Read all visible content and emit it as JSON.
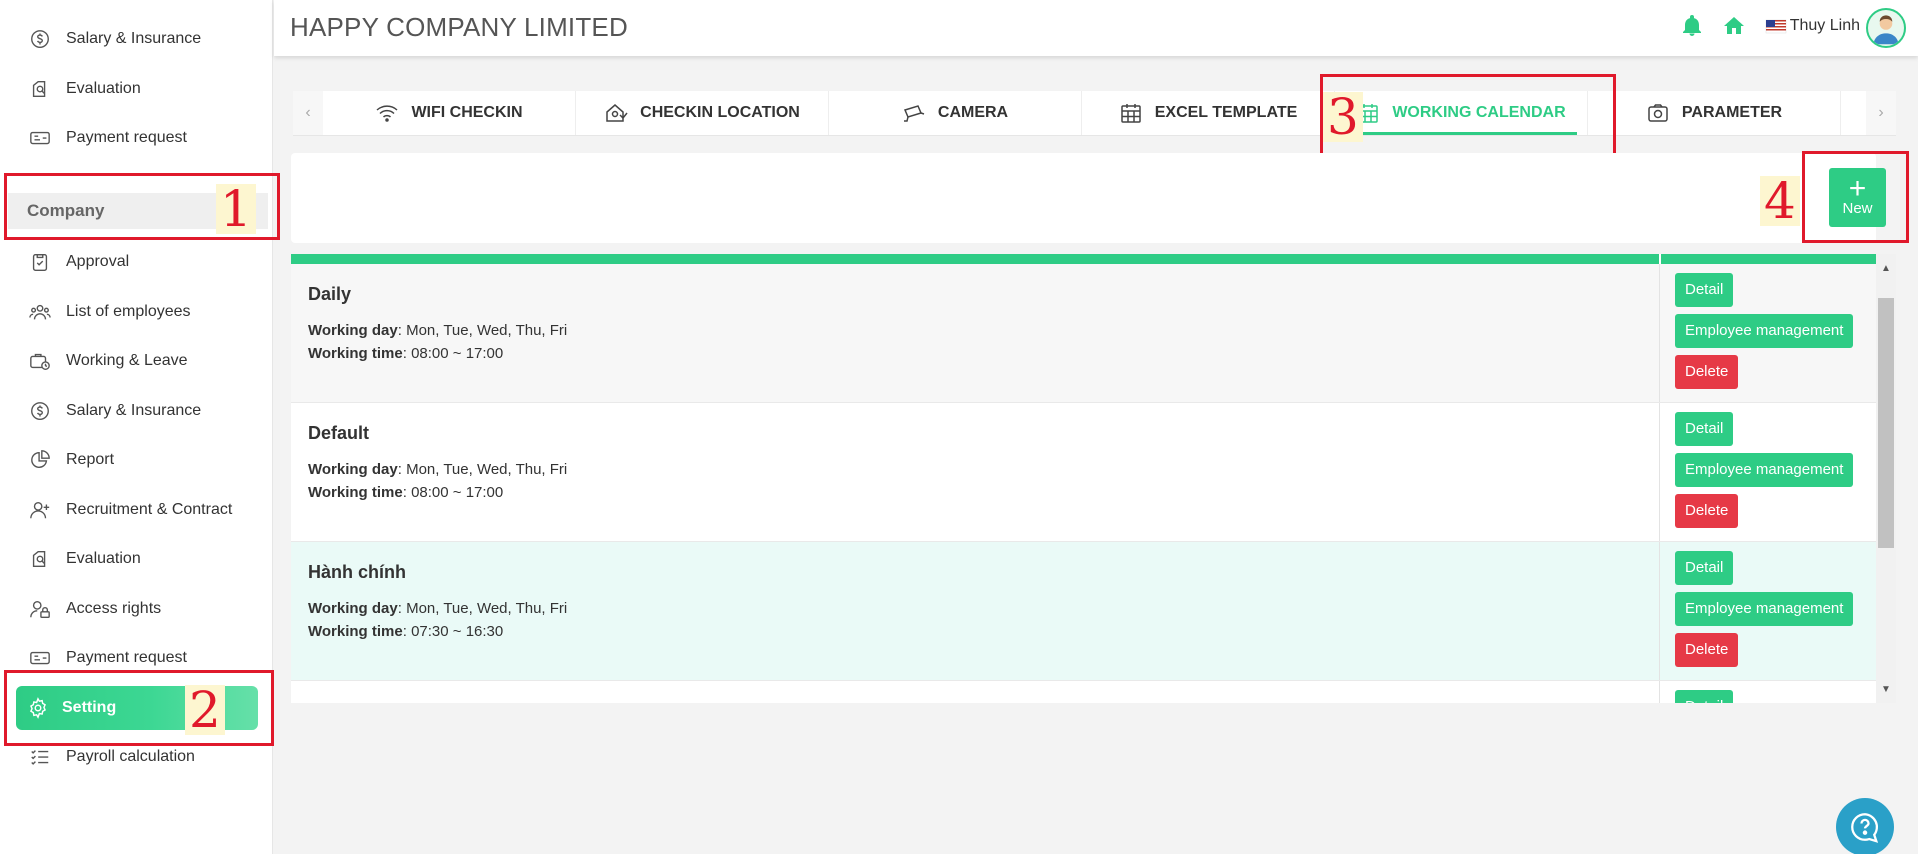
{
  "sidebar": {
    "items_top": [
      {
        "label": "Salary & Insurance",
        "icon": "dollar-icon"
      },
      {
        "label": "Evaluation",
        "icon": "evaluation-icon"
      },
      {
        "label": "Payment request",
        "icon": "payment-icon"
      }
    ],
    "section_title": "Company",
    "items": [
      {
        "label": "Approval",
        "icon": "clipboard-check-icon"
      },
      {
        "label": "List of employees",
        "icon": "users-icon"
      },
      {
        "label": "Working & Leave",
        "icon": "briefcase-clock-icon"
      },
      {
        "label": "Salary & Insurance",
        "icon": "dollar-icon"
      },
      {
        "label": "Report",
        "icon": "pie-chart-icon"
      },
      {
        "label": "Recruitment & Contract",
        "icon": "user-plus-icon"
      },
      {
        "label": "Evaluation",
        "icon": "evaluation-icon"
      },
      {
        "label": "Access rights",
        "icon": "user-lock-icon"
      },
      {
        "label": "Payment request",
        "icon": "payment-icon"
      }
    ],
    "active_item": {
      "label": "Setting",
      "icon": "gear-icon"
    },
    "items_bottom": [
      {
        "label": "Payroll calculation",
        "icon": "checklist-icon"
      }
    ]
  },
  "header": {
    "company_name": "HAPPY COMPANY LIMITED",
    "user_name": "Thuy Linh",
    "icons": [
      "bell-icon",
      "home-icon",
      "us-flag-icon"
    ]
  },
  "tabs": [
    {
      "label": "WIFI CHECKIN",
      "icon": "wifi-icon"
    },
    {
      "label": "CHECKIN LOCATION",
      "icon": "location-icon"
    },
    {
      "label": "CAMERA",
      "icon": "camera-icon"
    },
    {
      "label": "EXCEL TEMPLATE",
      "icon": "calendar-grid-icon"
    },
    {
      "label": "WORKING CALENDAR",
      "icon": "calendar-icon",
      "active": true
    },
    {
      "label": "PARAMETER",
      "icon": "photo-icon"
    }
  ],
  "new_button": {
    "label": "New",
    "symbol": "+"
  },
  "labels": {
    "working_day": "Working day",
    "working_time": "Working time"
  },
  "calendars": [
    {
      "name": "Daily",
      "working_day": ": Mon, Tue, Wed, Thu, Fri",
      "working_time": ": 08:00 ~ 17:00"
    },
    {
      "name": "Default",
      "working_day": ": Mon, Tue, Wed, Thu, Fri",
      "working_time": ": 08:00 ~ 17:00"
    },
    {
      "name": "Hành chính",
      "working_day": ": Mon, Tue, Wed, Thu, Fri",
      "working_time": ": 07:30 ~ 16:30"
    }
  ],
  "row_actions": {
    "detail": "Detail",
    "employee_management": "Employee management",
    "delete": "Delete"
  },
  "annotations": [
    "1",
    "2",
    "3",
    "4"
  ],
  "colors": {
    "accent": "#2ecc85",
    "danger": "#e63946",
    "annotation": "#e0192b"
  }
}
